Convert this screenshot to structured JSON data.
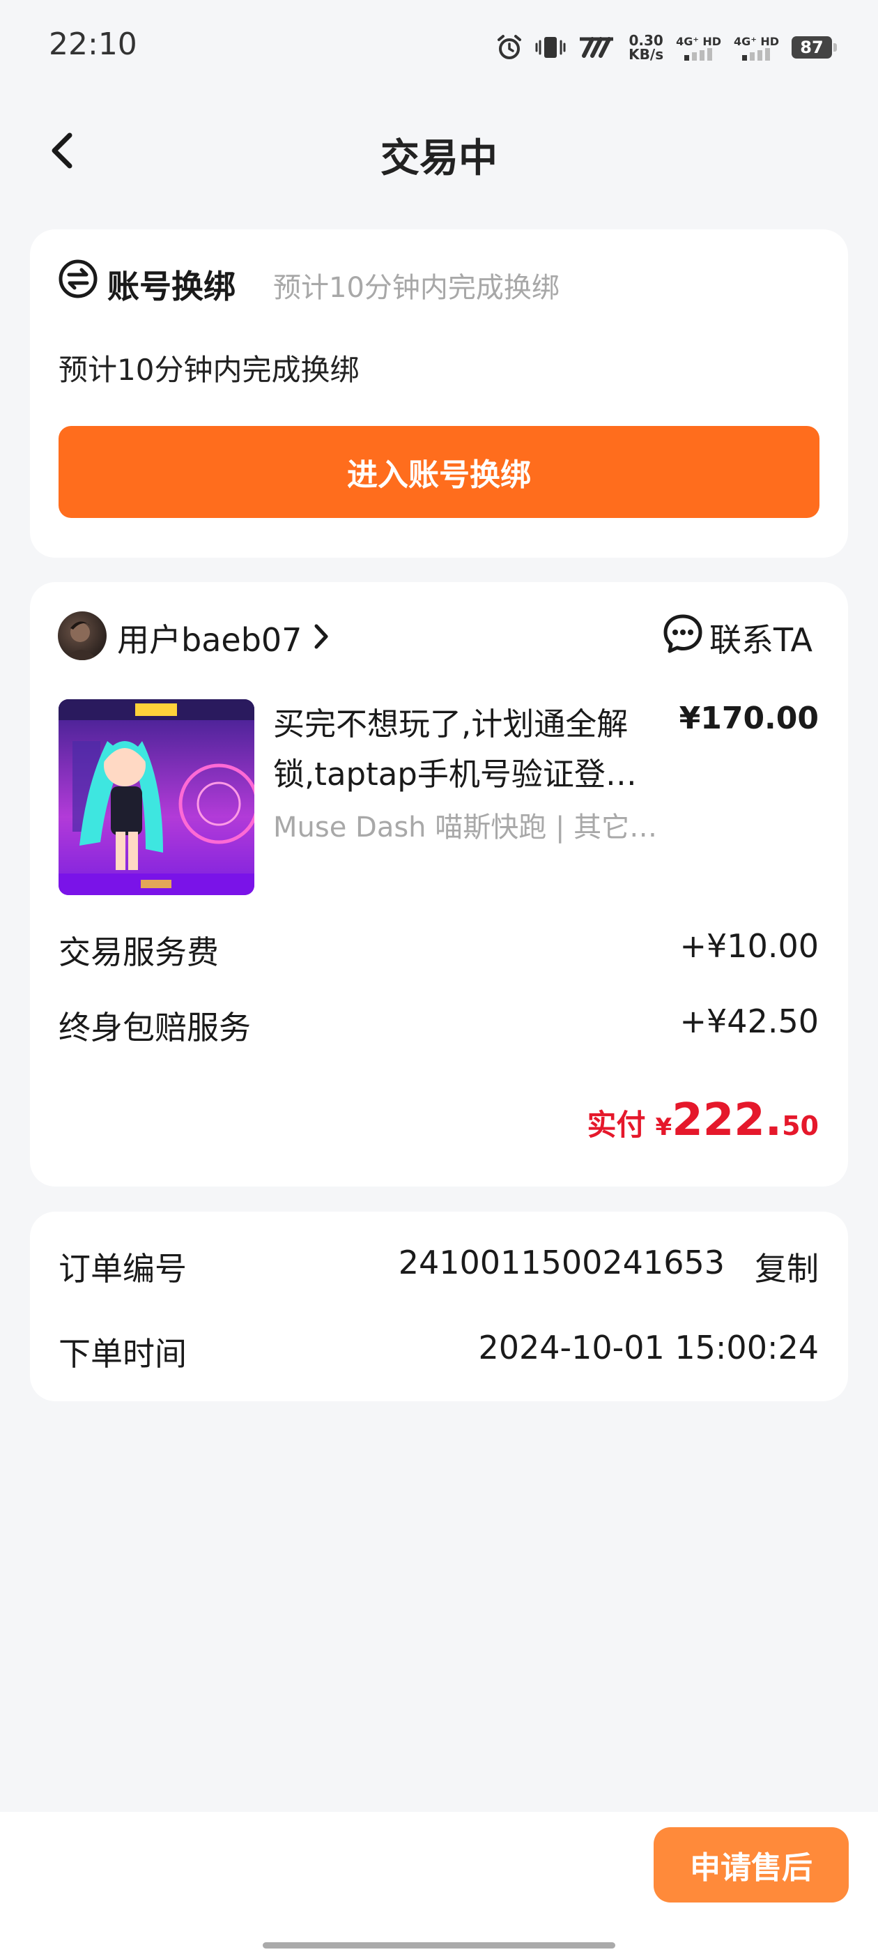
{
  "status_bar": {
    "time": "22:10",
    "net_speed_value": "0.30",
    "net_speed_unit": "KB/s",
    "sim1_label": "4G⁺ HD",
    "sim2_label": "4G⁺ HD",
    "battery": "87"
  },
  "header": {
    "title": "交易中"
  },
  "binding_card": {
    "title": "账号换绑",
    "hint": "预计10分钟内完成换绑",
    "description": "预计10分钟内完成换绑",
    "button_label": "进入账号换绑"
  },
  "order_card": {
    "seller_name": "用户baeb07",
    "contact_label": "联系TA",
    "item": {
      "title_line1": "买完不想玩了,计划通全解",
      "title_line2": "锁,taptap手机号验证登…",
      "price": "¥170.00",
      "subtitle": "Muse Dash 喵斯快跑 | 其它…"
    },
    "fees": [
      {
        "label": "交易服务费",
        "value": "+¥10.00"
      },
      {
        "label": "终身包赔服务",
        "value": "+¥42.50"
      }
    ],
    "paid": {
      "label": "实付",
      "currency": "¥",
      "integer": "222.",
      "decimal": "50"
    }
  },
  "order_info": {
    "order_no_label": "订单编号",
    "order_no": "2410011500241653",
    "copy_label": "复制",
    "time_label": "下单时间",
    "time_value": "2024-10-01 15:00:24"
  },
  "bottom_bar": {
    "after_sale_label": "申请售后"
  },
  "colors": {
    "accent_orange": "#ff6d1d",
    "price_red": "#e5182b",
    "background": "#f5f6f8"
  }
}
